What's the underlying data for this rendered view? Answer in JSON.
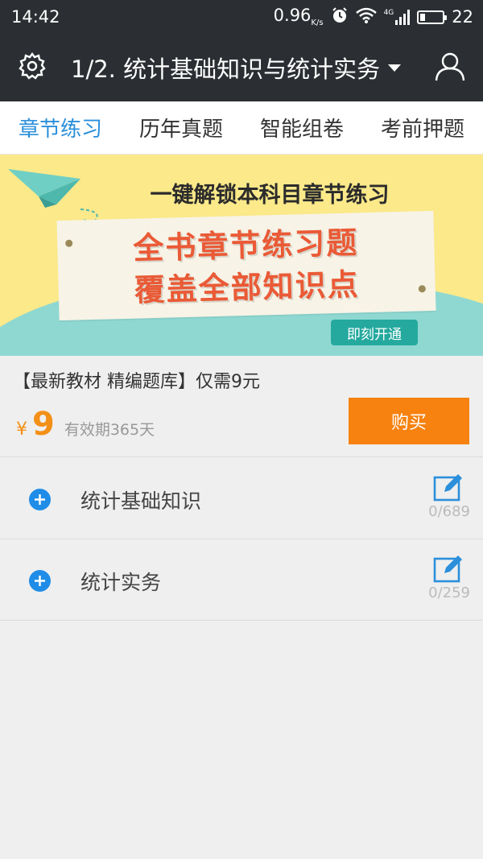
{
  "status_bar": {
    "time": "14:42",
    "net_speed": "0.96",
    "net_speed_unit": "K/s",
    "network_type": "4G",
    "battery": "22"
  },
  "header": {
    "title": "1/2. 统计基础知识与统计实务",
    "left_icon": "gear-icon",
    "right_icon": "user-icon"
  },
  "tabs": [
    {
      "label": "章节练习",
      "active": true
    },
    {
      "label": "历年真题",
      "active": false
    },
    {
      "label": "智能组卷",
      "active": false
    },
    {
      "label": "考前押题",
      "active": false
    }
  ],
  "banner": {
    "headline": "一键解锁本科目章节练习",
    "line1": "全书章节练习题",
    "line2": "覆盖全部知识点",
    "cta": "即刻开通",
    "colors": {
      "background": "#fbe98a",
      "wave": "#8fd8d2",
      "accent": "#ea5a36",
      "cta": "#25a99e"
    }
  },
  "product": {
    "title": "【最新教材 精编题库】仅需9元",
    "currency": "¥",
    "price": "9",
    "validity": "有效期365天",
    "buy_label": "购买",
    "colors": {
      "price": "#f39017",
      "button": "#f7820f"
    }
  },
  "chapters": [
    {
      "name": "统计基础知识",
      "progress": "0/689"
    },
    {
      "name": "统计实务",
      "progress": "0/259"
    }
  ],
  "theme": {
    "header_bg": "#2b2f33",
    "accent": "#2b8fdb",
    "icon_blue": "#1f8de8"
  }
}
